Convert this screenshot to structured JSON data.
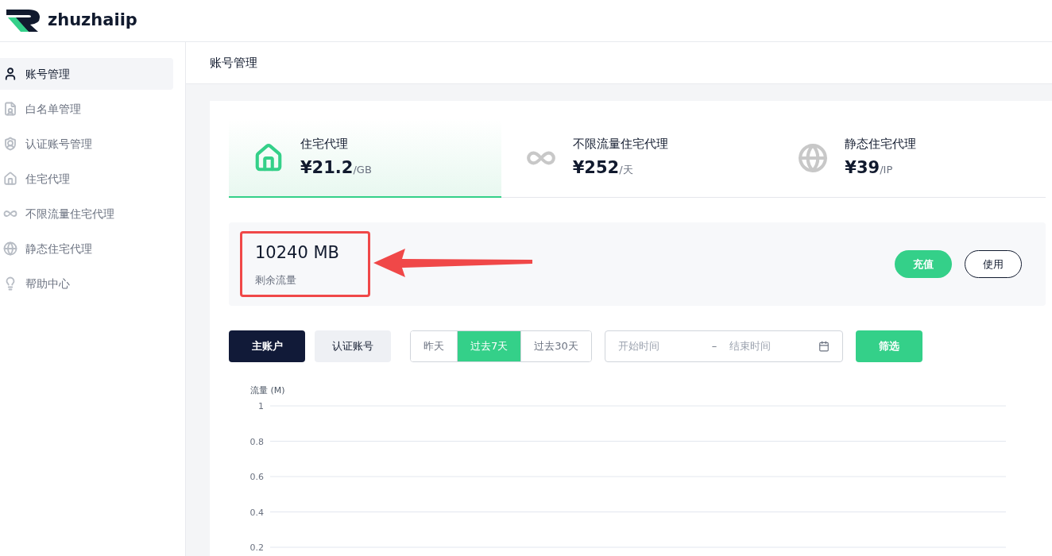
{
  "brand": {
    "name": "zhuzhaiip"
  },
  "sidebar": {
    "items": [
      {
        "label": "账号管理",
        "selected": true
      },
      {
        "label": "白名单管理",
        "selected": false
      },
      {
        "label": "认证账号管理",
        "selected": false
      },
      {
        "label": "住宅代理",
        "selected": false
      },
      {
        "label": "不限流量住宅代理",
        "selected": false
      },
      {
        "label": "静态住宅代理",
        "selected": false
      },
      {
        "label": "帮助中心",
        "selected": false
      }
    ]
  },
  "page_title": "账号管理",
  "plans": [
    {
      "name": "住宅代理",
      "price": "¥21.2",
      "unit": "/GB",
      "selected": true
    },
    {
      "name": "不限流量住宅代理",
      "price": "¥252",
      "unit": "/天",
      "selected": false
    },
    {
      "name": "静态住宅代理",
      "price": "¥39",
      "unit": "/IP",
      "selected": false
    }
  ],
  "balance": {
    "value": "10240 MB",
    "label": "剩余流量",
    "highlighted": true
  },
  "balance_buttons": [
    {
      "label": "充值",
      "kind": "primary"
    },
    {
      "label": "使用",
      "kind": "outline"
    }
  ],
  "account_tabs": [
    {
      "label": "主账户",
      "selected": true
    },
    {
      "label": "认证账号",
      "selected": false
    }
  ],
  "ranges": [
    {
      "label": "昨天",
      "selected": false
    },
    {
      "label": "过去7天",
      "selected": true
    },
    {
      "label": "过去30天",
      "selected": false
    }
  ],
  "date_range": {
    "start_placeholder": "开始时间",
    "separator": "–",
    "end_placeholder": "结束时间"
  },
  "filter_button": "筛选",
  "chart": {
    "y_axis_label": "流量 (M)",
    "y_ticks": [
      "1",
      "0.8",
      "0.6",
      "0.4",
      "0.2"
    ]
  }
}
